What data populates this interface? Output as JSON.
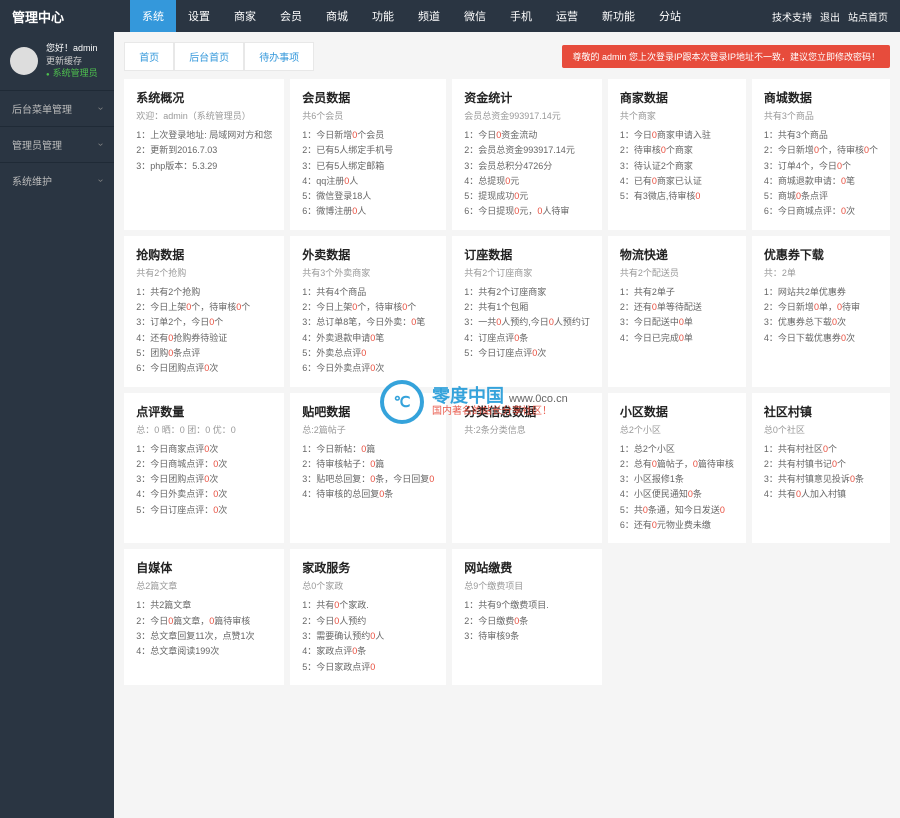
{
  "logo": "管理中心",
  "topnav": [
    "系统",
    "设置",
    "商家",
    "会员",
    "商城",
    "功能",
    "频道",
    "微信",
    "手机",
    "运营",
    "新功能",
    "分站"
  ],
  "toplinks": [
    "技术支持",
    "退出",
    "站点首页"
  ],
  "user": {
    "greeting": "您好！admin",
    "cache": "更新缓存",
    "role": "系统管理员"
  },
  "sidenav": [
    "后台菜单管理",
    "管理员管理",
    "系统维护"
  ],
  "breadcrumb": [
    "首页",
    "后台首页",
    "待办事项"
  ],
  "alert": "尊敬的 admin 您上次登录IP跟本次登录IP地址不一致，建议您立即修改密码！",
  "cards": [
    {
      "title": "系统概况",
      "sub": "欢迎：admin（系统管理员）",
      "items": [
        "1：上次登录地址: 局域网对方和您",
        "2：更新到2016.7.03",
        "3：php版本：5.3.29"
      ]
    },
    {
      "title": "会员数据",
      "sub": "共6个会员",
      "items": [
        "1：今日新增<span class='red'>0</span>个会员",
        "2：已有5人绑定手机号",
        "3：已有5人绑定邮箱",
        "4：qq注册<span class='red'>0</span>人",
        "5：微信登录18人",
        "6：微博注册<span class='red'>0</span>人"
      ]
    },
    {
      "title": "资金统计",
      "sub": "会员总资金993917.14元",
      "items": [
        "1：今日<span class='red'>0</span>资金流动",
        "2：会员总资金993917.14元",
        "3：会员总积分4726分",
        "4：总提现<span class='red'>0</span>元",
        "5：提现成功<span class='red'>0</span>元",
        "6：今日提现<span class='red'>0</span>元，<span class='red'>0</span>人待审"
      ]
    },
    {
      "title": "商家数据",
      "sub": "共个商家",
      "items": [
        "1：今日<span class='red'>0</span>商家申请入驻",
        "2：待审核<span class='red'>0</span>个商家",
        "3：待认证2个商家",
        "4：已有<span class='red'>0</span>商家已认证",
        "5：有3微店,待审核<span class='red'>0</span>"
      ]
    },
    {
      "title": "商城数据",
      "sub": "共有3个商品",
      "items": [
        "1：共有3个商品",
        "2：今日新增<span class='red'>0</span>个，待审核<span class='red'>0</span>个",
        "3：订单4个，今日<span class='red'>0</span>个",
        "4：商城退款申请：<span class='red'>0</span>笔",
        "5：商城<span class='red'>0</span>条点评",
        "6：今日商城点评：<span class='red'>0</span>次"
      ]
    },
    {
      "title": "抢购数据",
      "sub": "共有2个抢购",
      "items": [
        "1：共有2个抢购",
        "2：今日上架<span class='red'>0</span>个，待审核<span class='red'>0</span>个",
        "3：订单2个，今日<span class='red'>0</span>个",
        "4：还有<span class='red'>0</span>抢购券待验证",
        "5：团购<span class='red'>0</span>条点评",
        "6：今日团购点评<span class='red'>0</span>次"
      ]
    },
    {
      "title": "外卖数据",
      "sub": "共有3个外卖商家",
      "items": [
        "1：共有4个商品",
        "2：今日上架<span class='red'>0</span>个，待审核<span class='red'>0</span>个",
        "3：总订单8笔，今日外卖：<span class='red'>0</span>笔",
        "4：外卖退款申请<span class='red'>0</span>笔",
        "5：外卖总点评<span class='red'>0</span>",
        "6：今日外卖点评<span class='red'>0</span>次"
      ]
    },
    {
      "title": "订座数据",
      "sub": "共有2个订座商家",
      "items": [
        "1：共有2个订座商家",
        "2：共有1个包厢",
        "3：一共<span class='red'>0</span>人预约,今日<span class='red'>0</span>人预约订",
        "4：订座点评<span class='red'>0</span>条",
        "5：今日订座点评<span class='red'>0</span>次"
      ]
    },
    {
      "title": "物流快递",
      "sub": "共有2个配送员",
      "items": [
        "1：共有2单子",
        "2：还有<span class='red'>0</span>单等待配送",
        "3：今日配送中<span class='red'>0</span>单",
        "4：今日已完成<span class='red'>0</span>单"
      ]
    },
    {
      "title": "优惠券下载",
      "sub": "共：2单",
      "items": [
        "1：网站共2单优惠券",
        "2：今日新增<span class='red'>0</span>单，<span class='red'>0</span>待审",
        "3：优惠券总下载<span class='red'>0</span>次",
        "4：今日下载优惠券<span class='red'>0</span>次"
      ]
    },
    {
      "title": "点评数量",
      "sub": "总：0 晒：0 团：0 优：0",
      "items": [
        "1：今日商家点评<span class='red'>0</span>次",
        "2：今日商城点评：<span class='red'>0</span>次",
        "3：今日团购点评<span class='red'>0</span>次",
        "4：今日外卖点评：<span class='red'>0</span>次",
        "5：今日订座点评：<span class='red'>0</span>次"
      ]
    },
    {
      "title": "贴吧数据",
      "sub": "总:2篇帖子",
      "items": [
        "1：今日新帖：<span class='red'>0</span>篇",
        "2：待审核帖子：<span class='red'>0</span>篇",
        "3：贴吧总回复：<span class='red'>0</span>条，今日回复<span class='red'>0</span>",
        "4：待审核的总回复<span class='red'>0</span>条"
      ]
    },
    {
      "title": "分类信息数据",
      "sub": "共:2条分类信息",
      "items": []
    },
    {
      "title": "小区数据",
      "sub": "总2个小区",
      "items": [
        "1：总2个小区",
        "2：总有<span class='red'>0</span>篇帖子，<span class='red'>0</span>篇待审核",
        "3：小区报修1条",
        "4：小区便民通知<span class='red'>0</span>条",
        "5：共<span class='red'>0</span>条通，知今日发送<span class='red'>0</span>",
        "6：还有<span class='red'>0</span>元物业费未缴"
      ]
    },
    {
      "title": "社区村镇",
      "sub": "总0个社区",
      "items": [
        "1：共有村社区<span class='red'>0</span>个",
        "2：共有村镇书记<span class='red'>0</span>个",
        "3：共有村镇意见投诉<span class='red'>0</span>条",
        "4：共有<span class='red'>0</span>人加入村镇"
      ]
    },
    {
      "title": "自媒体",
      "sub": "总2篇文章",
      "items": [
        "1：共2篇文章",
        "2：今日<span class='red'>0</span>篇文章，<span class='red'>0</span>篇待审核",
        "3：总文章回复11次，点赞1次",
        "4：总文章阅读199次"
      ]
    },
    {
      "title": "家政服务",
      "sub": "总0个家政",
      "items": [
        "1：共有<span class='red'>0</span>个家政.",
        "2：今日<span class='red'>0</span>人预约",
        "3：需要确认预约<span class='red'>0</span>人",
        "4：家政点评<span class='red'>0</span>条",
        "5：今日家政点评<span class='red'>0</span>"
      ]
    },
    {
      "title": "网站缴费",
      "sub": "总9个缴费项目",
      "items": [
        "1：共有9个缴费项目.",
        "2：今日缴费<span class='red'>0</span>条",
        "3：待审核9条"
      ]
    }
  ],
  "watermark": {
    "symbol": "℃",
    "title": "零度中国",
    "url": "www.0co.cn",
    "tagline": "国内著名的站长分享社区！"
  }
}
